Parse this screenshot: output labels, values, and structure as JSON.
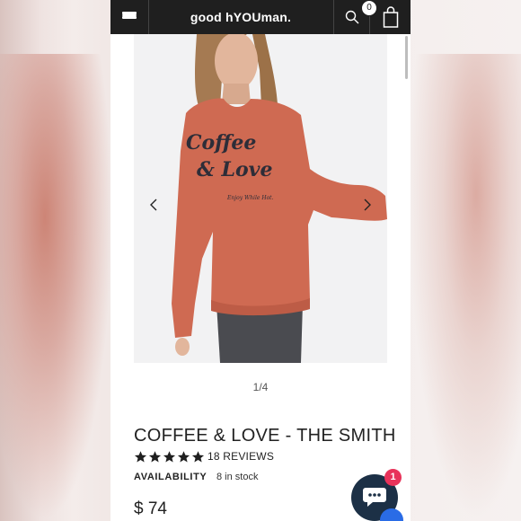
{
  "header": {
    "brand": "good hYOUman.",
    "cart_count": "0",
    "icons": {
      "menu": "hamburger-menu-icon",
      "search": "search-icon",
      "cart": "shopping-bag-icon"
    }
  },
  "gallery": {
    "image_text": {
      "line1": "Coffee",
      "line2": "& Love",
      "tagline": "Enjoy While Hot."
    },
    "pager": "1/4",
    "prev_icon": "chevron-left-icon",
    "next_icon": "chevron-right-icon"
  },
  "product": {
    "title": "COFFEE & LOVE - THE SMITH",
    "rating": 5,
    "reviews_label": "18 REVIEWS",
    "availability_label": "AVAILABILITY",
    "availability_value": "8 in stock",
    "price": "$ 74"
  },
  "chat": {
    "badge": "1",
    "icon": "chat-bubble-icon"
  },
  "colors": {
    "topbar": "#1f1f1f",
    "sweater": "#cf6a52",
    "chat_button": "#1c3046",
    "badge": "#e8335a",
    "accessibility": "#2a6ce6"
  }
}
